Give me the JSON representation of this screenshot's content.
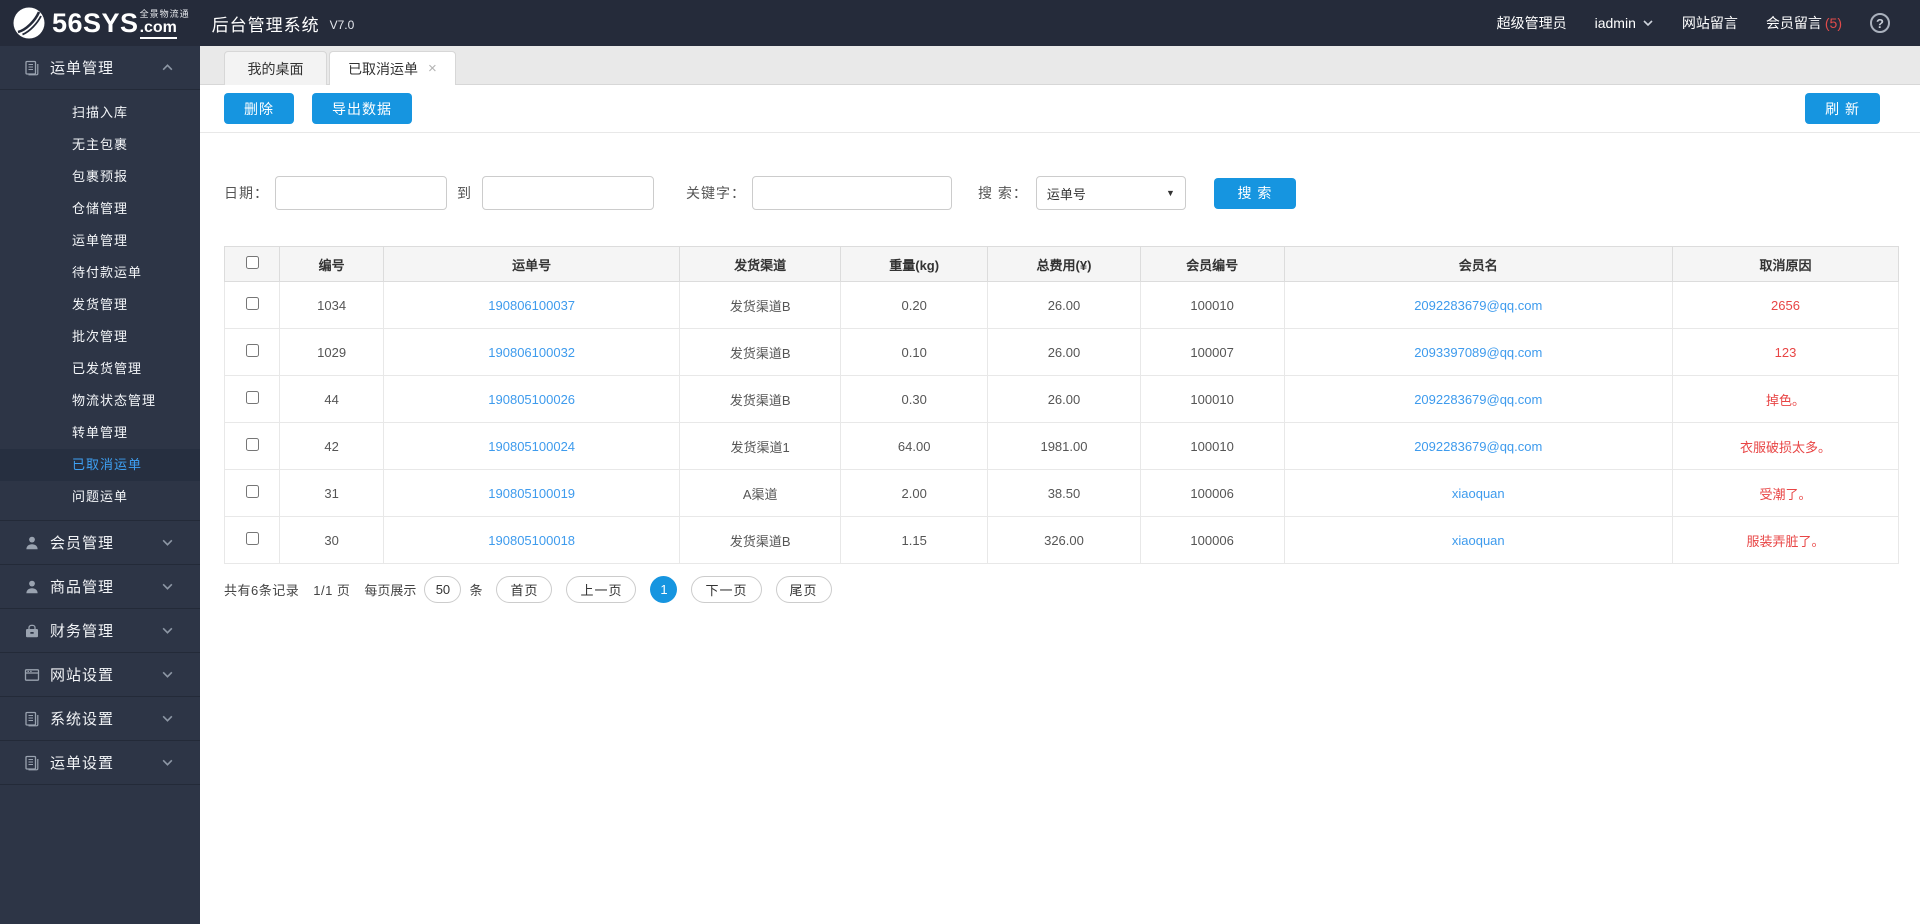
{
  "header": {
    "logo_main": "56SYS",
    "logo_domain": ".com",
    "logo_sub": "全景物流通",
    "title": "后台管理系统",
    "version": "V7.0",
    "role": "超级管理员",
    "username": "iadmin",
    "site_messages": "网站留言",
    "member_messages": "会员留言",
    "member_message_count": "(5)"
  },
  "sidebar": {
    "sections": [
      {
        "name": "waybill-management",
        "icon": "document-icon",
        "label": "运单管理",
        "expanded": true,
        "children": [
          {
            "name": "scan-inbound",
            "label": "扫描入库",
            "active": false
          },
          {
            "name": "unclaimed-packages",
            "label": "无主包裹",
            "active": false
          },
          {
            "name": "package-forecast",
            "label": "包裹预报",
            "active": false
          },
          {
            "name": "warehouse-management",
            "label": "仓储管理",
            "active": false
          },
          {
            "name": "waybill-management-sub",
            "label": "运单管理",
            "active": false
          },
          {
            "name": "pending-payment-waybills",
            "label": "待付款运单",
            "active": false
          },
          {
            "name": "shipping-management",
            "label": "发货管理",
            "active": false
          },
          {
            "name": "batch-management",
            "label": "批次管理",
            "active": false
          },
          {
            "name": "shipped-management",
            "label": "已发货管理",
            "active": false
          },
          {
            "name": "logistics-status-management",
            "label": "物流状态管理",
            "active": false
          },
          {
            "name": "transfer-management",
            "label": "转单管理",
            "active": false
          },
          {
            "name": "cancelled-waybills",
            "label": "已取消运单",
            "active": true
          },
          {
            "name": "problem-waybills",
            "label": "问题运单",
            "active": false
          }
        ]
      },
      {
        "name": "member-management",
        "icon": "user-icon",
        "label": "会员管理",
        "expanded": false
      },
      {
        "name": "product-management",
        "icon": "user-icon",
        "label": "商品管理",
        "expanded": false
      },
      {
        "name": "finance-management",
        "icon": "wallet-icon",
        "label": "财务管理",
        "expanded": false
      },
      {
        "name": "website-settings",
        "icon": "browser-icon",
        "label": "网站设置",
        "expanded": false
      },
      {
        "name": "system-settings",
        "icon": "document-icon",
        "label": "系统设置",
        "expanded": false
      },
      {
        "name": "waybill-settings",
        "icon": "document-icon",
        "label": "运单设置",
        "expanded": false
      }
    ]
  },
  "tabs": [
    {
      "name": "tab-my-desktop",
      "label": "我的桌面",
      "active": false,
      "closable": false
    },
    {
      "name": "tab-cancelled-waybills",
      "label": "已取消运单",
      "active": true,
      "closable": true
    }
  ],
  "toolbar": {
    "delete_label": "删除",
    "export_label": "导出数据",
    "refresh_label": "刷 新"
  },
  "filters": {
    "date_label": "日期：",
    "date_from_value": "",
    "to_label": "到",
    "date_to_value": "",
    "keyword_label": "关键字：",
    "keyword_value": "",
    "search_label": "搜 索：",
    "search_type_value": "运单号",
    "search_button_label": "搜 索"
  },
  "table": {
    "columns": [
      {
        "name": "id-column",
        "label": "编号"
      },
      {
        "name": "waybill-no-column",
        "label": "运单号"
      },
      {
        "name": "shipping-channel-column",
        "label": "发货渠道"
      },
      {
        "name": "weight-column",
        "label": "重量(kg)"
      },
      {
        "name": "total-fee-column",
        "label": "总费用(¥)"
      },
      {
        "name": "member-id-column",
        "label": "会员编号"
      },
      {
        "name": "member-name-column",
        "label": "会员名"
      },
      {
        "name": "cancel-reason-column",
        "label": "取消原因"
      }
    ],
    "rows": [
      {
        "id": "1034",
        "waybill_no": "190806100037",
        "channel": "发货渠道B",
        "weight": "0.20",
        "total_fee": "26.00",
        "member_id": "100010",
        "member_name": "2092283679@qq.com",
        "cancel_reason": "2656"
      },
      {
        "id": "1029",
        "waybill_no": "190806100032",
        "channel": "发货渠道B",
        "weight": "0.10",
        "total_fee": "26.00",
        "member_id": "100007",
        "member_name": "2093397089@qq.com",
        "cancel_reason": "123"
      },
      {
        "id": "44",
        "waybill_no": "190805100026",
        "channel": "发货渠道B",
        "weight": "0.30",
        "total_fee": "26.00",
        "member_id": "100010",
        "member_name": "2092283679@qq.com",
        "cancel_reason": "掉色。"
      },
      {
        "id": "42",
        "waybill_no": "190805100024",
        "channel": "发货渠道1",
        "weight": "64.00",
        "total_fee": "1981.00",
        "member_id": "100010",
        "member_name": "2092283679@qq.com",
        "cancel_reason": "衣服破损太多。"
      },
      {
        "id": "31",
        "waybill_no": "190805100019",
        "channel": "A渠道",
        "weight": "2.00",
        "total_fee": "38.50",
        "member_id": "100006",
        "member_name": "xiaoquan",
        "cancel_reason": "受潮了。"
      },
      {
        "id": "30",
        "waybill_no": "190805100018",
        "channel": "发货渠道B",
        "weight": "1.15",
        "total_fee": "326.00",
        "member_id": "100006",
        "member_name": "xiaoquan",
        "cancel_reason": "服装弄脏了。"
      }
    ]
  },
  "pagination": {
    "total_text": "共有6条记录",
    "page_text": "1/1 页",
    "per_page_prefix": "每页展示",
    "per_page_value": "50",
    "per_page_suffix": "条",
    "first_label": "首页",
    "prev_label": "上一页",
    "current_page": "1",
    "next_label": "下一页",
    "last_label": "尾页"
  },
  "colors": {
    "header_bg": "#252b3a",
    "sidebar_bg": "#2d3546",
    "accent_blue": "#1695e0",
    "link_blue": "#3e9bed",
    "active_menu_blue": "#3ea1f4",
    "danger_red": "#e84545",
    "table_header_bg": "#f5f5f5"
  }
}
